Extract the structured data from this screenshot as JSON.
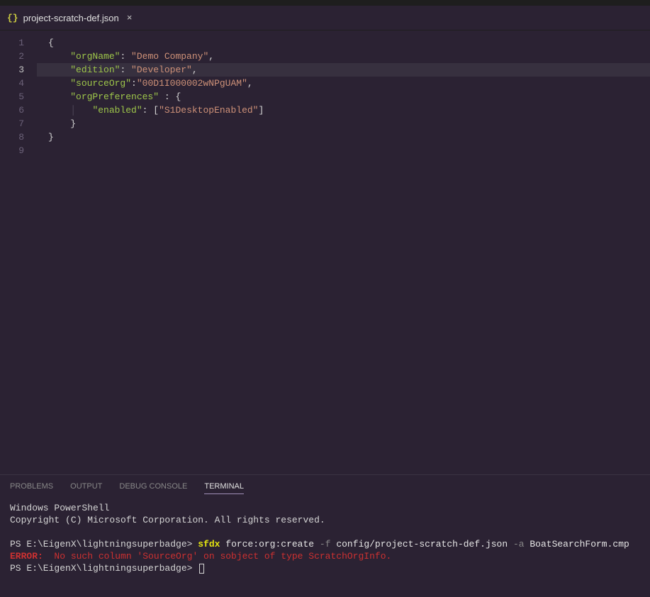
{
  "tab": {
    "icon": "{}",
    "label": "project-scratch-def.json",
    "close": "×"
  },
  "lines": {
    "n1": "1",
    "n2": "2",
    "n3": "3",
    "n4": "4",
    "n5": "5",
    "n6": "6",
    "n7": "7",
    "n8": "8",
    "n9": "9"
  },
  "code": {
    "l1_brace": "{",
    "l2_key": "\"orgName\"",
    "l2_colon": ": ",
    "l2_val": "\"Demo Company\"",
    "l2_comma": ",",
    "l3_key": "\"edition\"",
    "l3_colon": ": ",
    "l3_val": "\"Developer\"",
    "l3_comma": ",",
    "l4_key": "\"sourceOrg\"",
    "l4_colon": ":",
    "l4_val": "\"00D1I000002wNPgUAM\"",
    "l4_comma": ",",
    "l5_key": "\"orgPreferences\"",
    "l5_rest": " : {",
    "l6_key": "\"enabled\"",
    "l6_colon": ": [",
    "l6_val": "\"S1DesktopEnabled\"",
    "l6_close": "]",
    "l7_close": "}",
    "l8_brace": "}"
  },
  "panelTabs": {
    "problems": "PROBLEMS",
    "output": "OUTPUT",
    "debug": "DEBUG CONSOLE",
    "terminal": "TERMINAL"
  },
  "terminal": {
    "line1": "Windows PowerShell",
    "line2": "Copyright (C) Microsoft Corporation. All rights reserved.",
    "prompt1_pre": "PS E:\\EigenX\\lightningsuperbadge> ",
    "cmd_sfdx": "sfdx",
    "cmd_part1": " force:org:create ",
    "cmd_flag_f": "-f",
    "cmd_part2": " config/project-scratch-def.json ",
    "cmd_flag_a": "-a",
    "cmd_part3": " BoatSearchForm.cmp",
    "err_label": "ERROR:",
    "err_msg": "  No such column 'SourceOrg' on sobject of type ScratchOrgInfo.",
    "prompt2_pre": "PS E:\\EigenX\\lightningsuperbadge> "
  }
}
